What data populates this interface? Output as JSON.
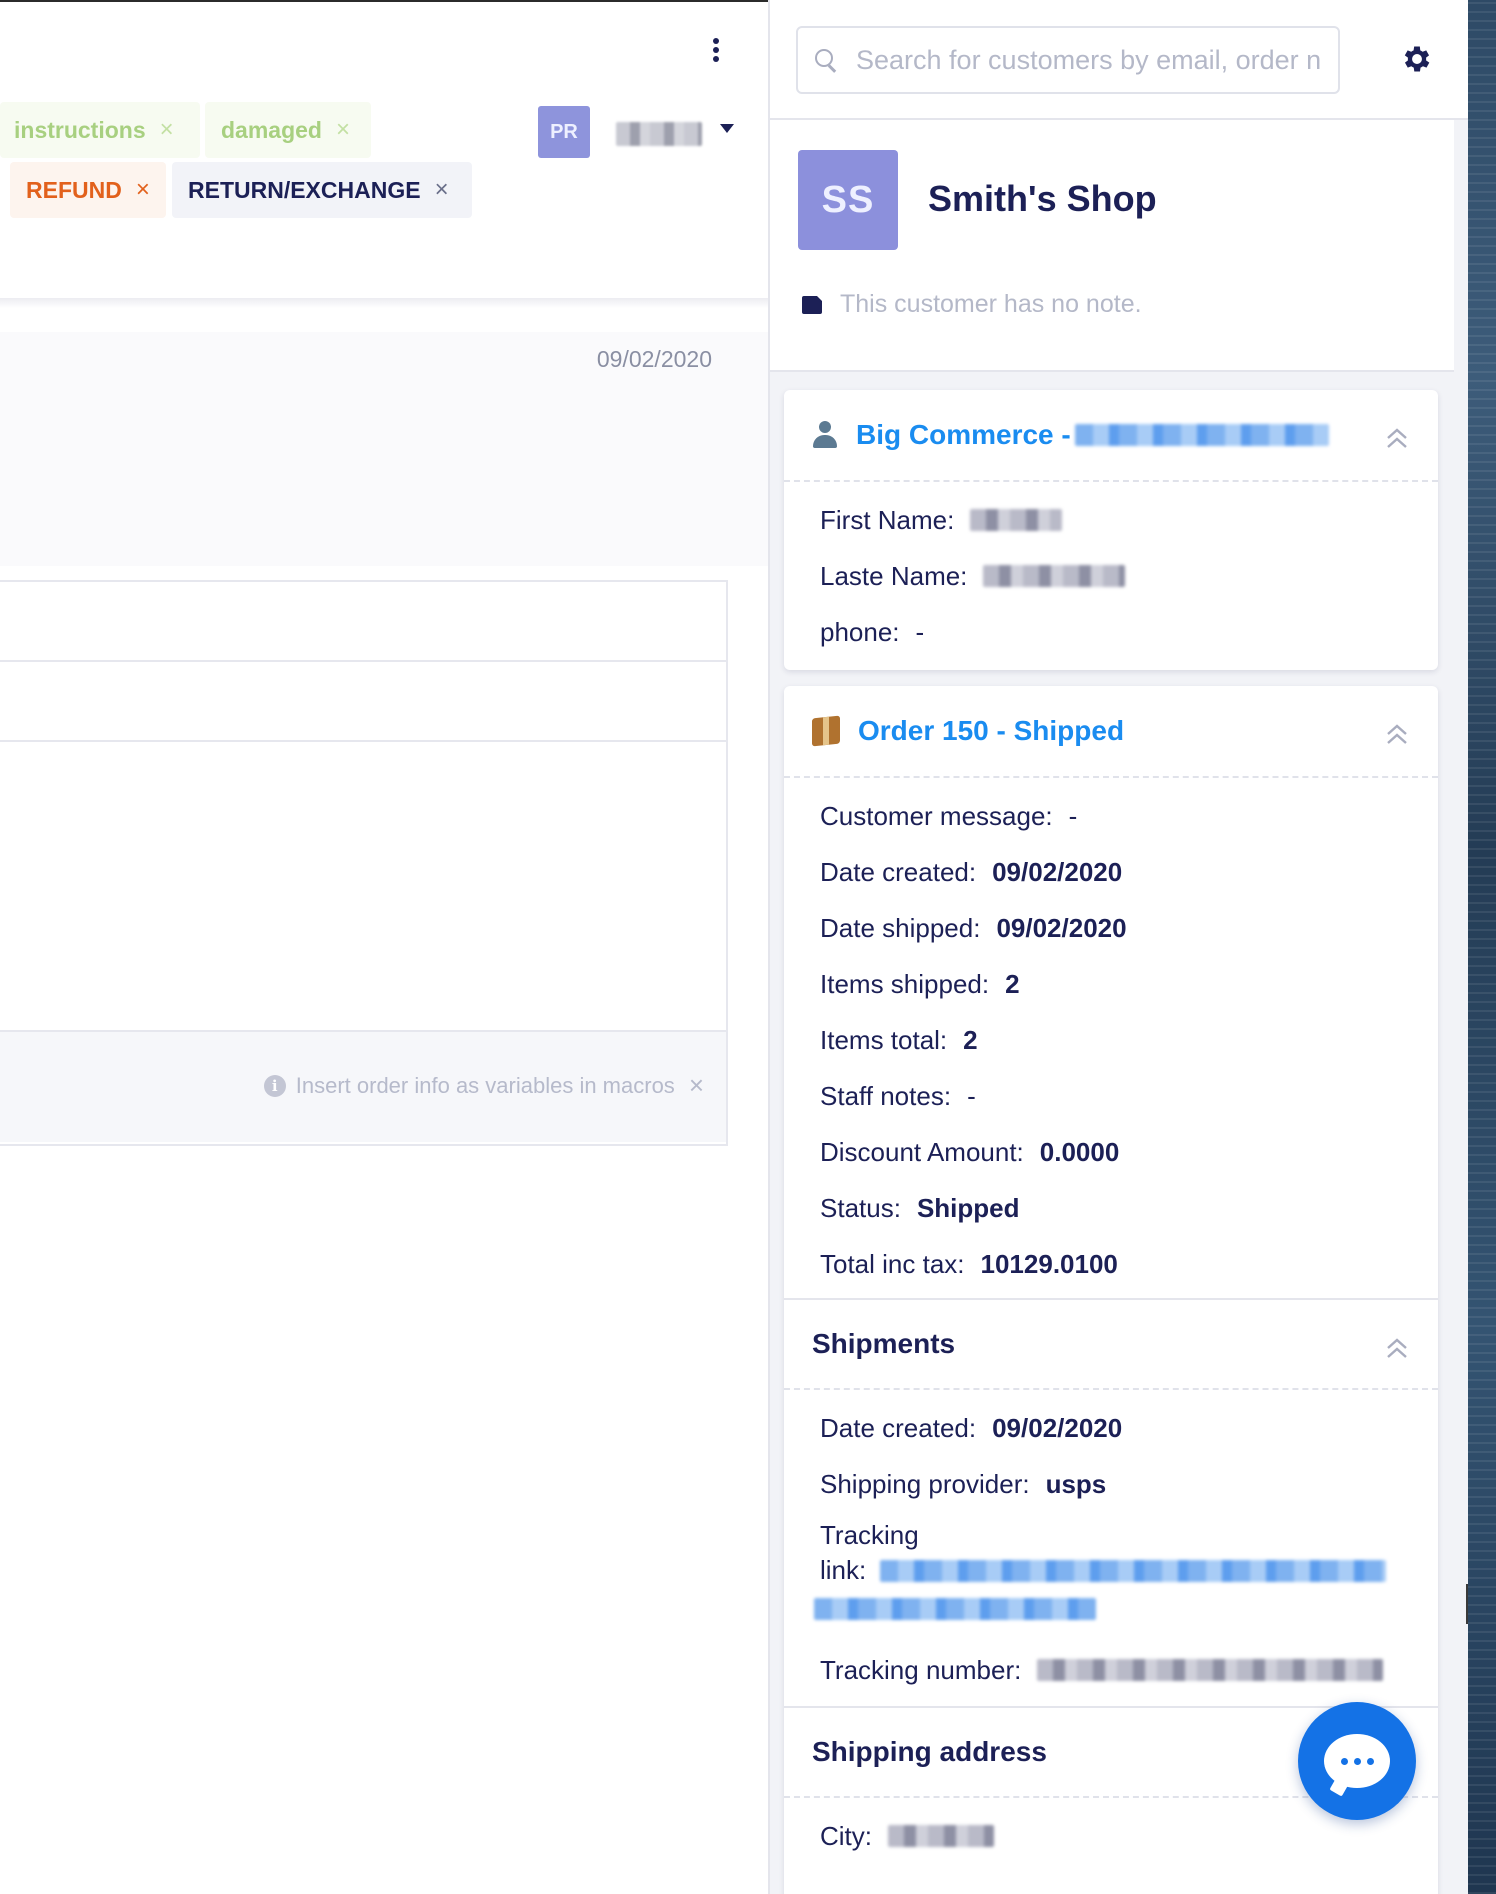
{
  "ticket": {
    "tags": [
      {
        "label": "instructions",
        "close": "×"
      },
      {
        "label": "damaged",
        "close": "×"
      },
      {
        "label": "REFUND",
        "close": "×"
      },
      {
        "label": "RETURN/EXCHANGE",
        "close": "×"
      }
    ],
    "assignee_initials": "PR",
    "message_date": "09/02/2020",
    "macro_hint": "Insert order info as variables in macros",
    "macro_hint_close": "×",
    "info_glyph": "i"
  },
  "search": {
    "placeholder": "Search for customers by email, order n"
  },
  "customer": {
    "initials": "SS",
    "name": "Smith's Shop",
    "note": "This customer has no note."
  },
  "bigcommerce": {
    "title": "Big Commerce - ",
    "fields": {
      "first_name_label": "First Name:",
      "last_name_label": "Laste Name:",
      "phone_label": "phone:",
      "phone_value": "-"
    }
  },
  "order": {
    "title": "Order 150 - Shipped",
    "fields": [
      {
        "label": "Customer message:",
        "value": "-"
      },
      {
        "label": "Date created:",
        "value": "09/02/2020"
      },
      {
        "label": "Date shipped:",
        "value": "09/02/2020"
      },
      {
        "label": "Items shipped:",
        "value": "2"
      },
      {
        "label": "Items total:",
        "value": "2"
      },
      {
        "label": "Staff notes:",
        "value": "-"
      },
      {
        "label": "Discount Amount:",
        "value": "0.0000"
      },
      {
        "label": "Status:",
        "value": "Shipped"
      },
      {
        "label": "Total inc tax:",
        "value": "10129.0100"
      }
    ]
  },
  "shipments": {
    "title": "Shipments",
    "date_created_label": "Date created:",
    "date_created_value": "09/02/2020",
    "provider_label": "Shipping provider:",
    "provider_value": "usps",
    "tracking_link_label_1": "Tracking",
    "tracking_link_label_2": "link:",
    "tracking_number_label": "Tracking number:"
  },
  "shipping_address": {
    "title": "Shipping address",
    "city_label": "City:"
  },
  "colors": {
    "accent_blue": "#1a8cf0",
    "navy": "#1c2056",
    "avatar_purple": "#8c90dc",
    "chat_blue": "#1472e6"
  }
}
